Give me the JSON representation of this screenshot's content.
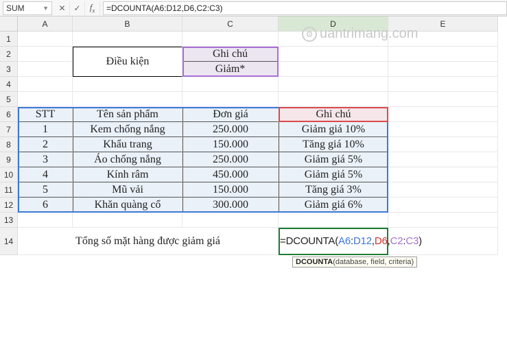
{
  "namebox": "SUM",
  "formula_bar": "=DCOUNTA(A6:D12,D6,C2:C3)",
  "col_headers": [
    "A",
    "B",
    "C",
    "D",
    "E"
  ],
  "row_headers": [
    "1",
    "2",
    "3",
    "4",
    "5",
    "6",
    "7",
    "8",
    "9",
    "10",
    "11",
    "12",
    "13",
    "14"
  ],
  "cells": {
    "B2": "Điều kiện",
    "C2": "Ghi chú",
    "C3": "Giảm*",
    "A6": "STT",
    "B6": "Tên sản phẩm",
    "C6": "Đơn giá",
    "D6": "Ghi chú",
    "A7": "1",
    "B7": "Kem chống nắng",
    "C7": "250.000",
    "D7": "Giảm giá 10%",
    "A8": "2",
    "B8": "Khẩu trang",
    "C8": "150.000",
    "D8": "Tăng giá 10%",
    "A9": "3",
    "B9": "Áo chống nắng",
    "C9": "250.000",
    "D9": "Giảm giá 5%",
    "A10": "4",
    "B10": "Kính râm",
    "C10": "450.000",
    "D10": "Giảm giá 5%",
    "A11": "5",
    "B11": "Mũ vải",
    "C11": "150.000",
    "D11": "Tăng giá 3%",
    "A12": "6",
    "B12": "Khăn quàng cổ",
    "C12": "300.000",
    "D12": "Giảm giá 6%",
    "A14_label": "Tổng số mặt hàng được giảm giá"
  },
  "formula_cell": {
    "eq": "=",
    "fn": "DCOUNTA",
    "open": "(",
    "a": "A6",
    "colon": ":",
    "b": "D12",
    "comma": ",",
    "c": "D6",
    "d": "C2",
    "colon2": ":",
    "e": "C3",
    "close": ")"
  },
  "tooltip": {
    "fn": "DCOUNTA",
    "args": "(database, field, criteria)"
  },
  "watermark": "uantrimang.com",
  "icons": {
    "cancel": "✕",
    "accept": "✓"
  },
  "chart_data": {
    "type": "table",
    "title": "Tổng số mặt hàng được giảm giá",
    "criteria": {
      "label": "Điều kiện",
      "field": "Ghi chú",
      "pattern": "Giảm*"
    },
    "columns": [
      "STT",
      "Tên sản phẩm",
      "Đơn giá",
      "Ghi chú"
    ],
    "rows": [
      [
        1,
        "Kem chống nắng",
        250000,
        "Giảm giá 10%"
      ],
      [
        2,
        "Khẩu trang",
        150000,
        "Tăng giá 10%"
      ],
      [
        3,
        "Áo chống nắng",
        250000,
        "Giảm giá 5%"
      ],
      [
        4,
        "Kính râm",
        450000,
        "Giảm giá 5%"
      ],
      [
        5,
        "Mũ vải",
        150000,
        "Tăng giá 3%"
      ],
      [
        6,
        "Khăn quàng cổ",
        300000,
        "Giảm giá 6%"
      ]
    ],
    "formula": "=DCOUNTA(A6:D12,D6,C2:C3)"
  }
}
